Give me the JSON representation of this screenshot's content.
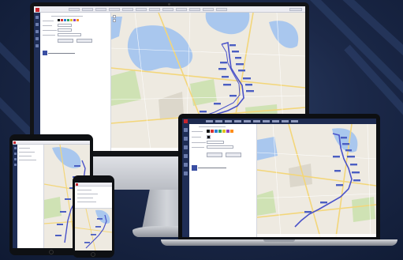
{
  "app": {
    "brand_color": "#c4262e",
    "rail_color": "#1f2e56",
    "route_color": "#4a52c9",
    "stop_label_color": "#4b5ec2",
    "water_color": "#a9c7ee",
    "park_color": "#cfe2b4",
    "road_color": "#f3d67a",
    "swatch_colors": [
      "#111111",
      "#d6322f",
      "#2b7fd8",
      "#2fa35a",
      "#e0c220",
      "#8e3fbf",
      "#ff8c1a"
    ],
    "icons": [
      "route-icon",
      "vehicle-icon",
      "layers-icon",
      "settings-icon",
      "user-icon"
    ]
  },
  "devices": [
    "desktop-monitor",
    "laptop",
    "tablet",
    "smartphone"
  ]
}
